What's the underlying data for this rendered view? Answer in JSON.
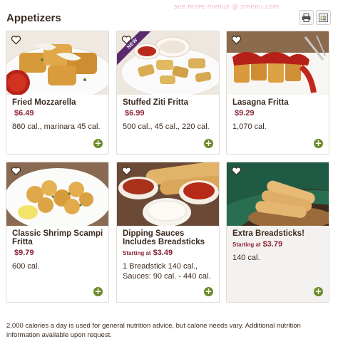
{
  "watermark": "see more menus @ zmenu.com",
  "header": {
    "title": "Appetizers",
    "print_icon": "printer-icon",
    "list_icon": "list-icon"
  },
  "items": [
    {
      "name": "Fried Mozzarella",
      "price_prefix": "",
      "price": "$6.49",
      "calories": "860 cal., marinara 45 cal.",
      "badge": ""
    },
    {
      "name": "Stuffed Ziti Fritta",
      "price_prefix": "",
      "price": "$6.99",
      "calories": "500 cal., 45 cal., 220 cal.",
      "badge": "NEW"
    },
    {
      "name": "Lasagna Fritta",
      "price_prefix": "",
      "price": "$9.29",
      "calories": "1,070 cal.",
      "badge": ""
    },
    {
      "name": "Classic Shrimp Scampi Fritta",
      "price_prefix": "",
      "price": "$9.79",
      "calories": "600 cal.",
      "badge": ""
    },
    {
      "name": "Dipping Sauces Includes Breadsticks",
      "price_prefix": "Starting at",
      "price": "$3.49",
      "calories": "1 Breadstick 140 cal., Sauces: 90 cal. - 440 cal.",
      "badge": ""
    },
    {
      "name": "Extra Breadsticks!",
      "price_prefix": "Starting at",
      "price": "$3.79",
      "calories": "140 cal.",
      "badge": ""
    }
  ],
  "add_symbol": "+",
  "footnote": "2,000 calories a day is used for general nutrition advice, but calorie needs vary. Additional nutrition information available upon request.",
  "colors": {
    "price": "#8b2335",
    "add_button": "#6b8b2a",
    "ribbon": "#5a2a6e"
  }
}
